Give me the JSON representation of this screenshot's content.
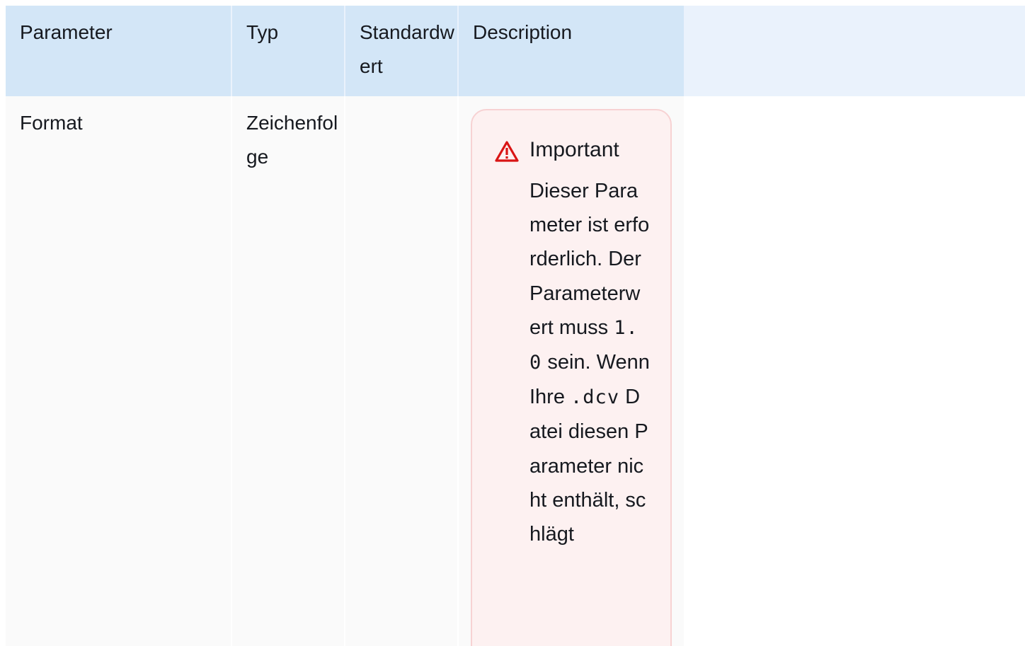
{
  "table": {
    "headers": {
      "parameter": "Parameter",
      "type": "Typ",
      "default": "Standardwert",
      "description": "Description"
    },
    "rows": [
      {
        "parameter": "Format",
        "type": "Zeichenfolge",
        "default": "",
        "alert": {
          "icon": "warning-triangle-icon",
          "title": "Important",
          "text_1": "Dieser Parameter ist erforderlich. Der Parameterwert muss",
          "code_1": "1.0",
          "text_2": "sein. Wenn Ihre",
          "code_2": ".dcv",
          "text_3": "Datei diesen Parameter nicht enthält, schlägt"
        }
      }
    ]
  },
  "colors": {
    "header_bg": "#d3e6f7",
    "alert_bg": "#fdf1f1",
    "alert_border": "#f7d2d3",
    "alert_icon": "#d91515"
  }
}
